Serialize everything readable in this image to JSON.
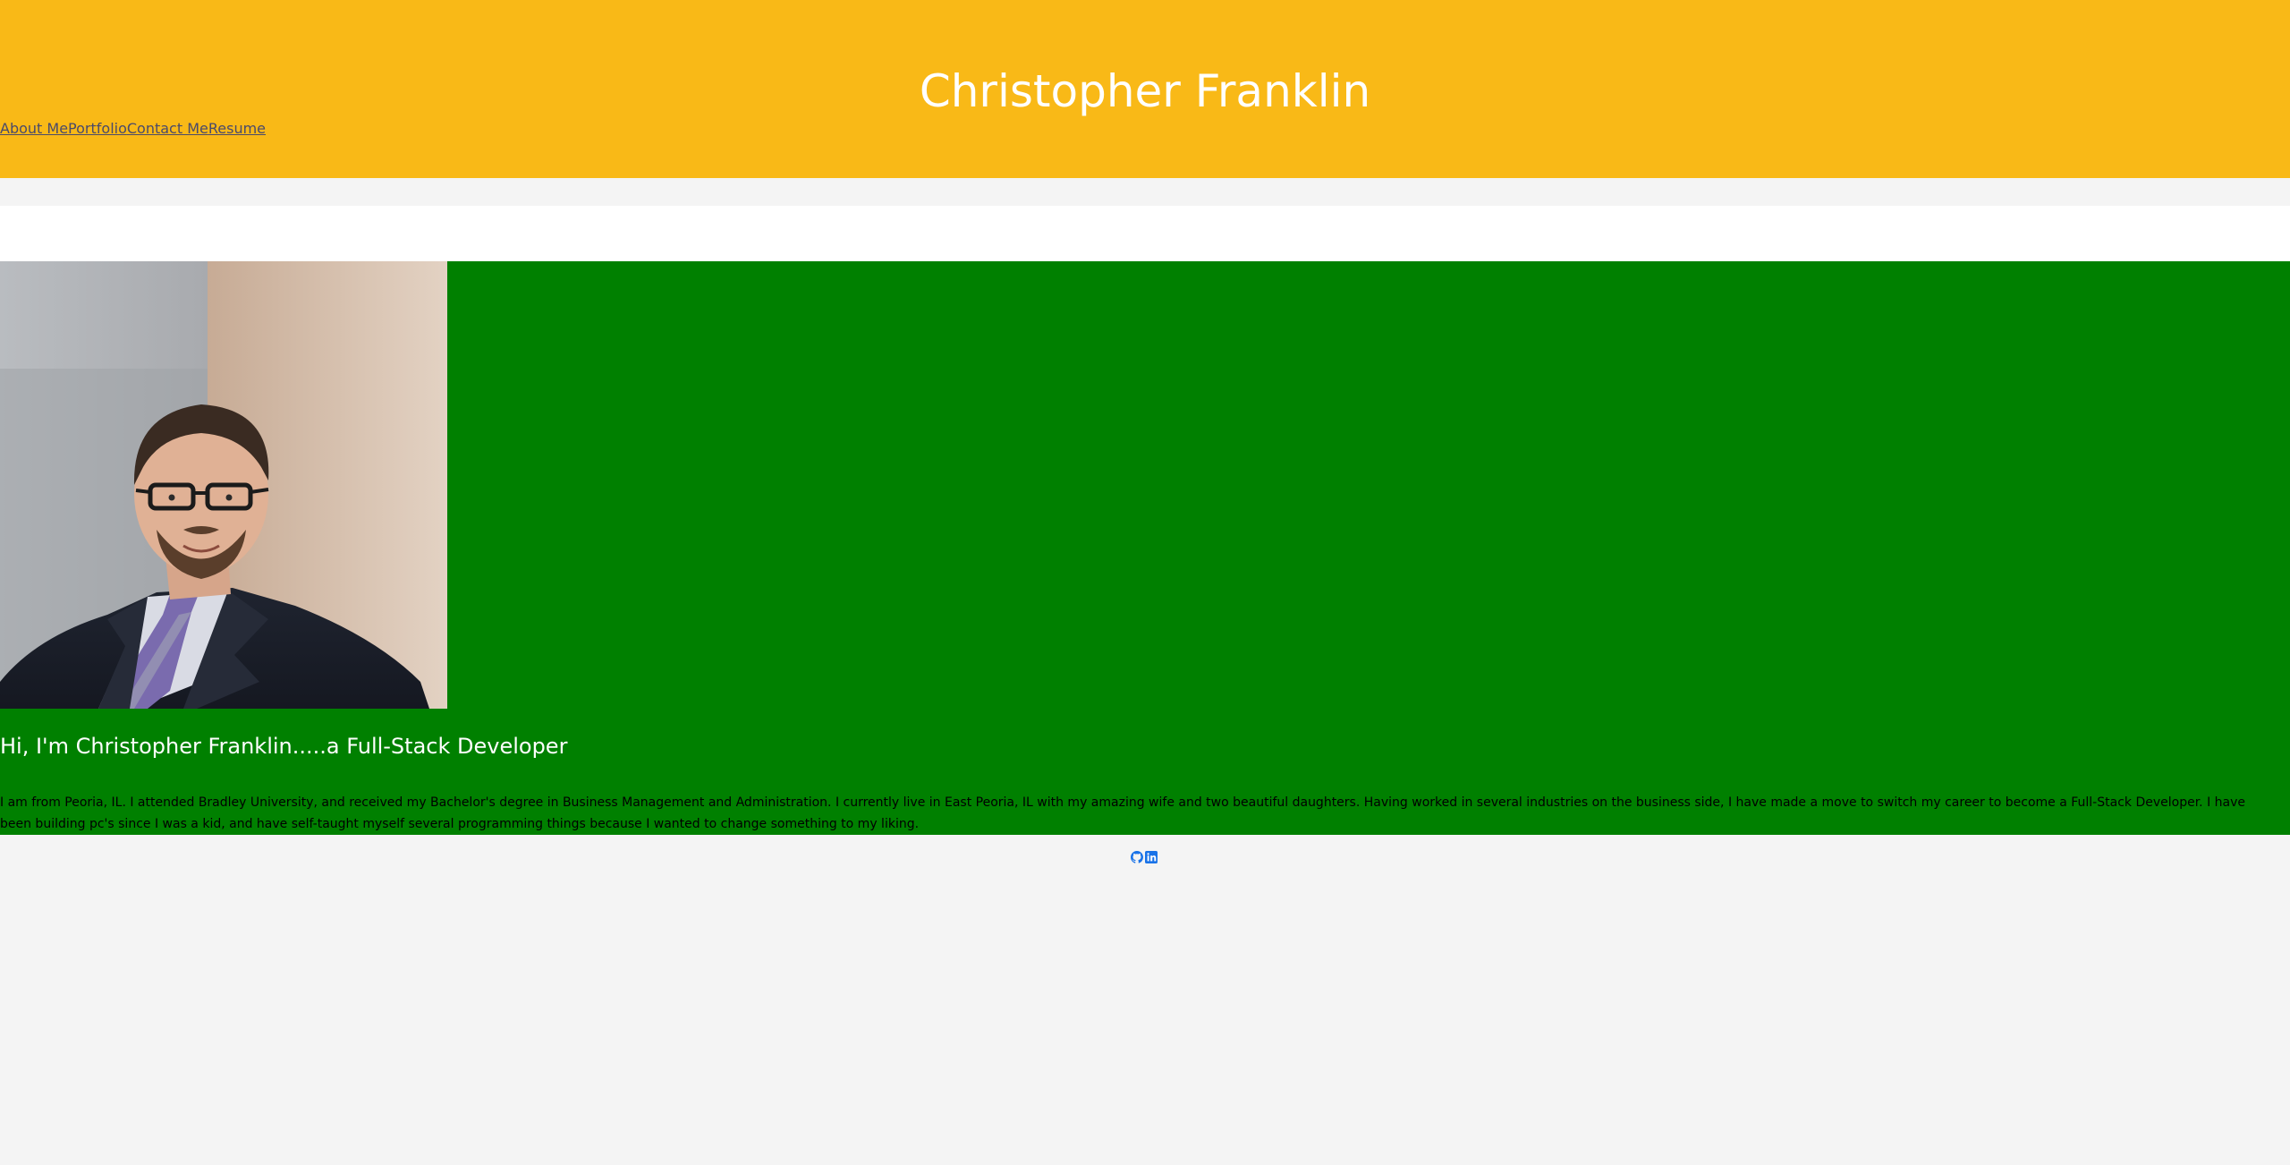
{
  "header": {
    "title": "Christopher Franklin",
    "nav": [
      "About Me",
      "Portfolio",
      "Contact Me",
      "Resume"
    ]
  },
  "about": {
    "photo": "portrait of Christopher Franklin",
    "heading": "Hi, I'm Christopher Franklin.....a Full-Stack Developer",
    "body": "I am from Peoria, IL. I attended Bradley University, and received my Bachelor's degree in Business Management and Administration. I currently live in East Peoria, IL with my amazing wife and two beautiful daughters. Having worked in several industries on the business side, I have made a move to switch my career to become a Full-Stack Developer. I have been building pc's since I was a kid, and have self-taught myself several programming things because I wanted to change something to my liking."
  },
  "footer": {
    "icons": [
      "github-icon",
      "linkedin-icon"
    ]
  },
  "colors": {
    "header_bg": "#f9b917",
    "about_bg": "#008000",
    "page_bg": "#f4f4f4",
    "icon": "#1a73e8"
  }
}
